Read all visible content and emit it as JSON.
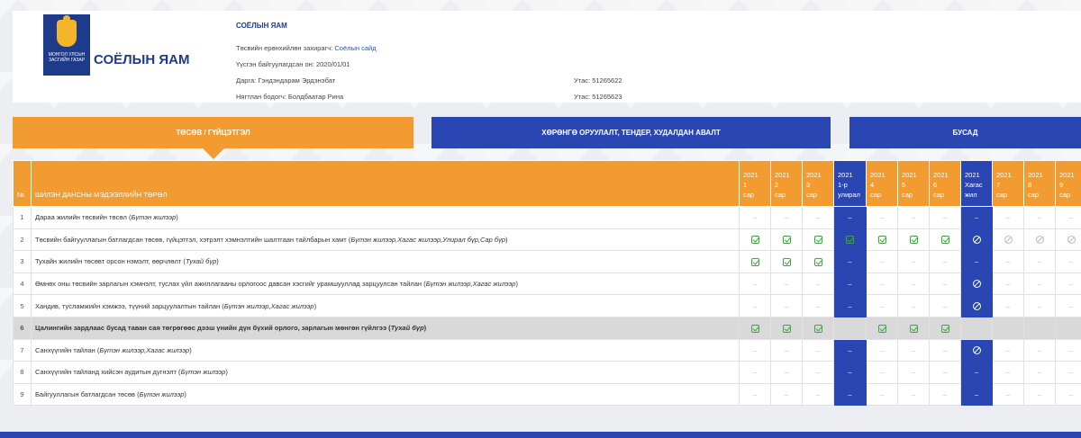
{
  "header": {
    "logo_org": "СОЁЛЫН ЯАМ",
    "emblem_text": "МОНГОЛ УЛСЫН ЗАСГИЙН ГАЗАР",
    "title": "СОЁЛЫН ЯАМ",
    "manager_label": "Төсвийн ерөнхийлөн захирагч:",
    "manager_value": "Соёлын сайд",
    "founded": "Үүсгэн байгуулагдсан он: 2020/01/01",
    "director": "Дарга: Гэндэндарам Эрдэнэбат",
    "director_phone": "Утас: 51265622",
    "accountant": "Нягтлан бодогч: Болдбаатар Рина",
    "accountant_phone": "Утас: 51265623"
  },
  "tabs": [
    {
      "label": "Төсөв / гүйцэтгэл"
    },
    {
      "label": "Хөрөнгө оруулалт, тендер, худалдан авалт"
    },
    {
      "label": "Бусад"
    }
  ],
  "table": {
    "col_no": "№",
    "col_name": "Шилэн дансны мэдээллийн төрөл",
    "periods": [
      "2021 1 сар",
      "2021 2 сар",
      "2021 3 сар",
      "2021 1-р улирал",
      "2021 4 сар",
      "2021 5 сар",
      "2021 6 сар",
      "2021 Хагас жил",
      "2021 7 сар",
      "2021 8 сар",
      "2021 9 сар"
    ],
    "rows": [
      {
        "no": "1",
        "name": "Дараа жилийн төсвийн төсөл",
        "tag": "Бүтэн жилээр"
      },
      {
        "no": "2",
        "name": "Төсвийн байгууллагын батлагдсан төсөв, гүйцэтгэл, хэтрэлт хэмнэлтийн шалтгаан тайлбарын хамт",
        "tag": "Бүтэн жилээр,Хагас жилээр,Улирал бүр,Сар бүр"
      },
      {
        "no": "3",
        "name": "Тухайн жилийн төсөвт орсон нэмэлт, өөрчлөлт",
        "tag": "Тухай бүр"
      },
      {
        "no": "4",
        "name": "Өмнөх оны төсвийн зарлагын хэмнэлт, туслах үйл ажиллагааны орлогоос давсан хэсгийг урамшууллад зарцуулсан тайлан",
        "tag": "Бүтэн жилээр,Хагас жилээр"
      },
      {
        "no": "5",
        "name": "Хандив, тусламжийн хэмжээ, түүний зарцуулалтын тайлан",
        "tag": "Бүтэн жилээр,Хагас жилээр"
      },
      {
        "no": "6",
        "name": "Цалингийн зардлаас бусад таван сая төгрөгөөс дээш үнийн дүн бүхий орлого, зарлагын мөнгөн гүйлгээ",
        "tag": "Тухай бүр"
      },
      {
        "no": "7",
        "name": "Санхүүгийн тайлан",
        "tag": "Бүтэн жилээр,Хагас жилээр"
      },
      {
        "no": "8",
        "name": "Санхүүгийн тайланд хийсэн аудитын дүгнэлт",
        "tag": "Бүтэн жилээр"
      },
      {
        "no": "9",
        "name": "Байгууллагын батлагдсан төсөв",
        "tag": "Бүтэн жилээр"
      }
    ],
    "status": [
      [
        "d",
        "d",
        "d",
        "d",
        "d",
        "d",
        "d",
        "d",
        "d",
        "d",
        "d"
      ],
      [
        "c",
        "c",
        "c",
        "c",
        "c",
        "c",
        "c",
        "b",
        "b",
        "b",
        "b"
      ],
      [
        "c",
        "c",
        "c",
        "d",
        "d",
        "d",
        "d",
        "d",
        "d",
        "d",
        "d"
      ],
      [
        "d",
        "d",
        "d",
        "d",
        "d",
        "d",
        "d",
        "b",
        "d",
        "d",
        "d"
      ],
      [
        "d",
        "d",
        "d",
        "d",
        "d",
        "d",
        "d",
        "b",
        "d",
        "d",
        "d"
      ],
      [
        "c",
        "c",
        "c",
        "e",
        "c",
        "c",
        "c",
        "e",
        "e",
        "e",
        "e"
      ],
      [
        "d",
        "d",
        "d",
        "d",
        "d",
        "d",
        "d",
        "b",
        "d",
        "d",
        "d"
      ],
      [
        "d",
        "d",
        "d",
        "d",
        "d",
        "d",
        "d",
        "d",
        "d",
        "d",
        "d"
      ],
      [
        "d",
        "d",
        "d",
        "d",
        "d",
        "d",
        "d",
        "d",
        "d",
        "d",
        "d"
      ]
    ],
    "dash": "–"
  }
}
